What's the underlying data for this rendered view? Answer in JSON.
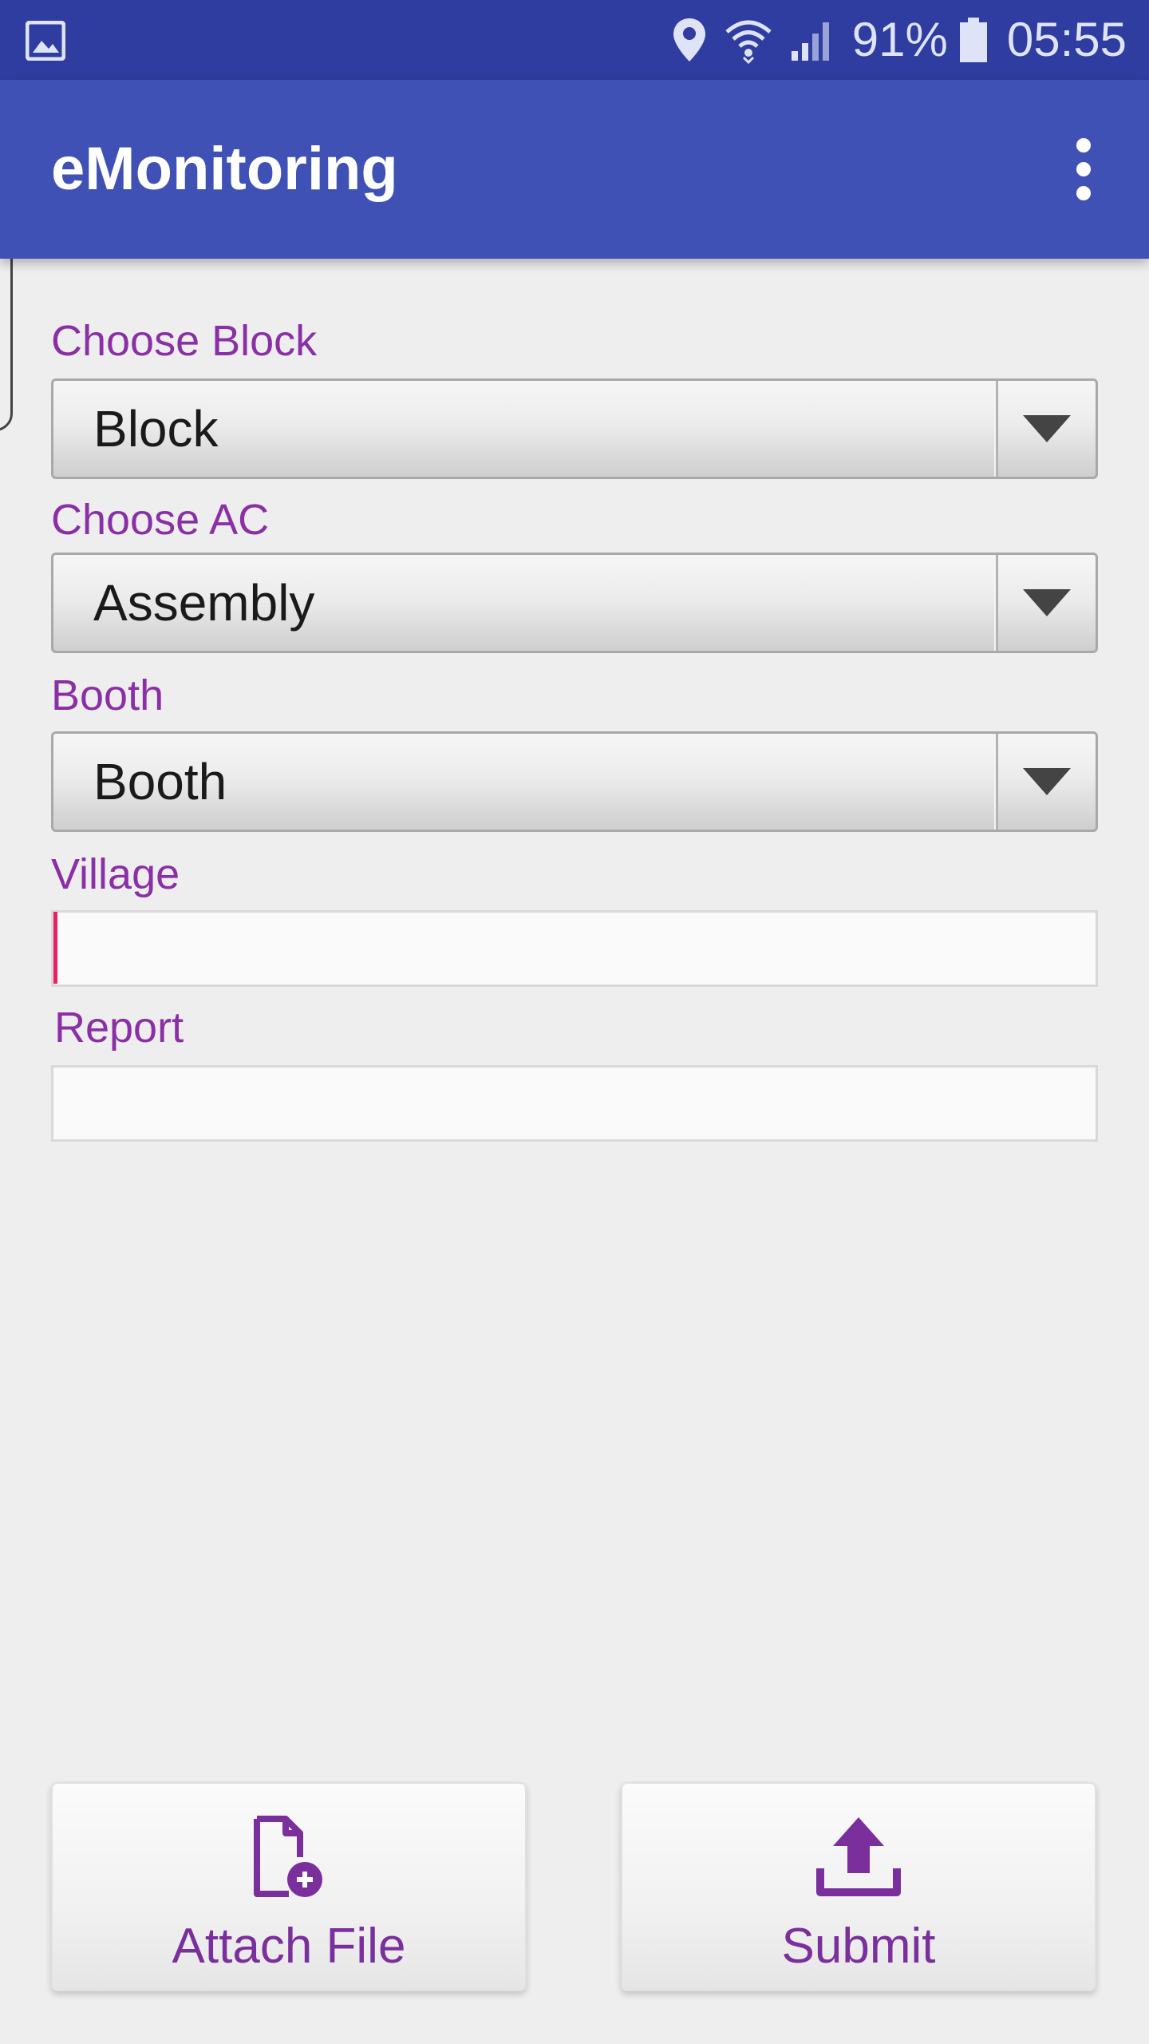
{
  "status_bar": {
    "battery_percent": "91%",
    "time": "05:55",
    "icons": [
      "gallery-icon",
      "location-icon",
      "wifi-icon",
      "signal-icon",
      "battery-icon"
    ]
  },
  "app_bar": {
    "title": "eMonitoring",
    "overflow_icon": "overflow-menu-icon"
  },
  "form": {
    "block": {
      "label": "Choose Block",
      "selected": "Block"
    },
    "ac": {
      "label": "Choose AC",
      "selected": "Assembly"
    },
    "booth": {
      "label": "Booth",
      "selected": "Booth"
    },
    "village": {
      "label": "Village",
      "value": ""
    },
    "report": {
      "label": "Report",
      "value": ""
    }
  },
  "actions": {
    "attach": {
      "label": "Attach File",
      "icon": "attach-file-icon"
    },
    "submit": {
      "label": "Submit",
      "icon": "upload-icon"
    }
  },
  "colors": {
    "status_bar": "#2e3d9f",
    "app_bar": "#3f51b5",
    "label": "#8a2fa6",
    "button_text": "#7b2f9c",
    "background": "#eeeeee",
    "cursor": "#e91e63"
  }
}
